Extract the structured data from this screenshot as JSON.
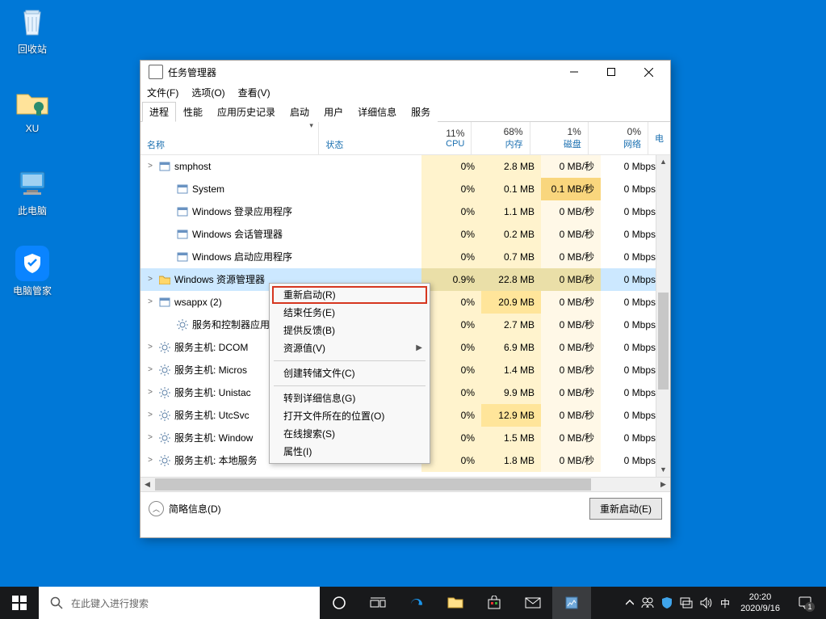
{
  "desktop": {
    "recycle": "回收站",
    "xu": "XU",
    "pc": "此电脑",
    "guard": "电脑管家"
  },
  "taskmgr": {
    "title": "任务管理器",
    "menus": {
      "file": "文件(F)",
      "options": "选项(O)",
      "view": "查看(V)"
    },
    "tabs": {
      "processes": "进程",
      "performance": "性能",
      "history": "应用历史记录",
      "startup": "启动",
      "users": "用户",
      "details": "详细信息",
      "services": "服务"
    },
    "columns": {
      "name": "名称",
      "status": "状态",
      "cpu": "CPU",
      "memory": "内存",
      "disk": "磁盘",
      "network": "网络",
      "extra": "电"
    },
    "usage": {
      "cpu": "11%",
      "memory": "68%",
      "disk": "1%",
      "network": "0%"
    },
    "rows": [
      {
        "exp": ">",
        "icon": "svc",
        "name": "smphost",
        "cpu": "0%",
        "mem": "2.8 MB",
        "disk": "0 MB/秒",
        "net": "0 Mbps"
      },
      {
        "exp": "",
        "icon": "sys",
        "name": "System",
        "cpu": "0%",
        "mem": "0.1 MB",
        "disk": "0.1 MB/秒",
        "diskwarm": true,
        "net": "0 Mbps",
        "inset": true
      },
      {
        "exp": "",
        "icon": "sys",
        "name": "Windows 登录应用程序",
        "cpu": "0%",
        "mem": "1.1 MB",
        "disk": "0 MB/秒",
        "net": "0 Mbps",
        "inset": true
      },
      {
        "exp": "",
        "icon": "sys",
        "name": "Windows 会话管理器",
        "cpu": "0%",
        "mem": "0.2 MB",
        "disk": "0 MB/秒",
        "net": "0 Mbps",
        "inset": true
      },
      {
        "exp": "",
        "icon": "sys",
        "name": "Windows 启动应用程序",
        "cpu": "0%",
        "mem": "0.7 MB",
        "disk": "0 MB/秒",
        "net": "0 Mbps",
        "inset": true
      },
      {
        "exp": ">",
        "icon": "exp",
        "name": "Windows 资源管理器",
        "cpu": "0.9%",
        "mem": "22.8 MB",
        "disk": "0 MB/秒",
        "net": "0 Mbps",
        "selected": true,
        "hot": true
      },
      {
        "exp": ">",
        "icon": "svc",
        "name": "wsappx (2)",
        "cpu": "0%",
        "mem": "20.9 MB",
        "disk": "0 MB/秒",
        "net": "0 Mbps",
        "hot": true
      },
      {
        "exp": "",
        "icon": "gear",
        "name": "服务和控制器应用",
        "cpu": "0%",
        "mem": "2.7 MB",
        "disk": "0 MB/秒",
        "net": "0 Mbps",
        "inset": true
      },
      {
        "exp": ">",
        "icon": "gear",
        "name": "服务主机: DCOM",
        "cpu": "0%",
        "mem": "6.9 MB",
        "disk": "0 MB/秒",
        "net": "0 Mbps"
      },
      {
        "exp": ">",
        "icon": "gear",
        "name": "服务主机: Micros",
        "cpu": "0%",
        "mem": "1.4 MB",
        "disk": "0 MB/秒",
        "net": "0 Mbps"
      },
      {
        "exp": ">",
        "icon": "gear",
        "name": "服务主机: Unistac",
        "cpu": "0%",
        "mem": "9.9 MB",
        "disk": "0 MB/秒",
        "net": "0 Mbps"
      },
      {
        "exp": ">",
        "icon": "gear",
        "name": "服务主机: UtcSvc",
        "cpu": "0%",
        "mem": "12.9 MB",
        "disk": "0 MB/秒",
        "net": "0 Mbps",
        "hot": true
      },
      {
        "exp": ">",
        "icon": "gear",
        "name": "服务主机: Window",
        "cpu": "0%",
        "mem": "1.5 MB",
        "disk": "0 MB/秒",
        "net": "0 Mbps"
      },
      {
        "exp": ">",
        "icon": "gear",
        "name": "服务主机: 本地服务",
        "cpu": "0%",
        "mem": "1.8 MB",
        "disk": "0 MB/秒",
        "net": "0 Mbps"
      }
    ],
    "context": {
      "restart": "重新启动(R)",
      "end": "结束任务(E)",
      "feedback": "提供反馈(B)",
      "resource": "资源值(V)",
      "dump": "创建转储文件(C)",
      "details": "转到详细信息(G)",
      "location": "打开文件所在的位置(O)",
      "search": "在线搜索(S)",
      "prop": "属性(I)"
    },
    "footer": {
      "fewer": "简略信息(D)",
      "restart": "重新启动(E)"
    }
  },
  "taskbar": {
    "search_placeholder": "在此键入进行搜索",
    "ime": "中",
    "time": "20:20",
    "date": "2020/9/16"
  }
}
